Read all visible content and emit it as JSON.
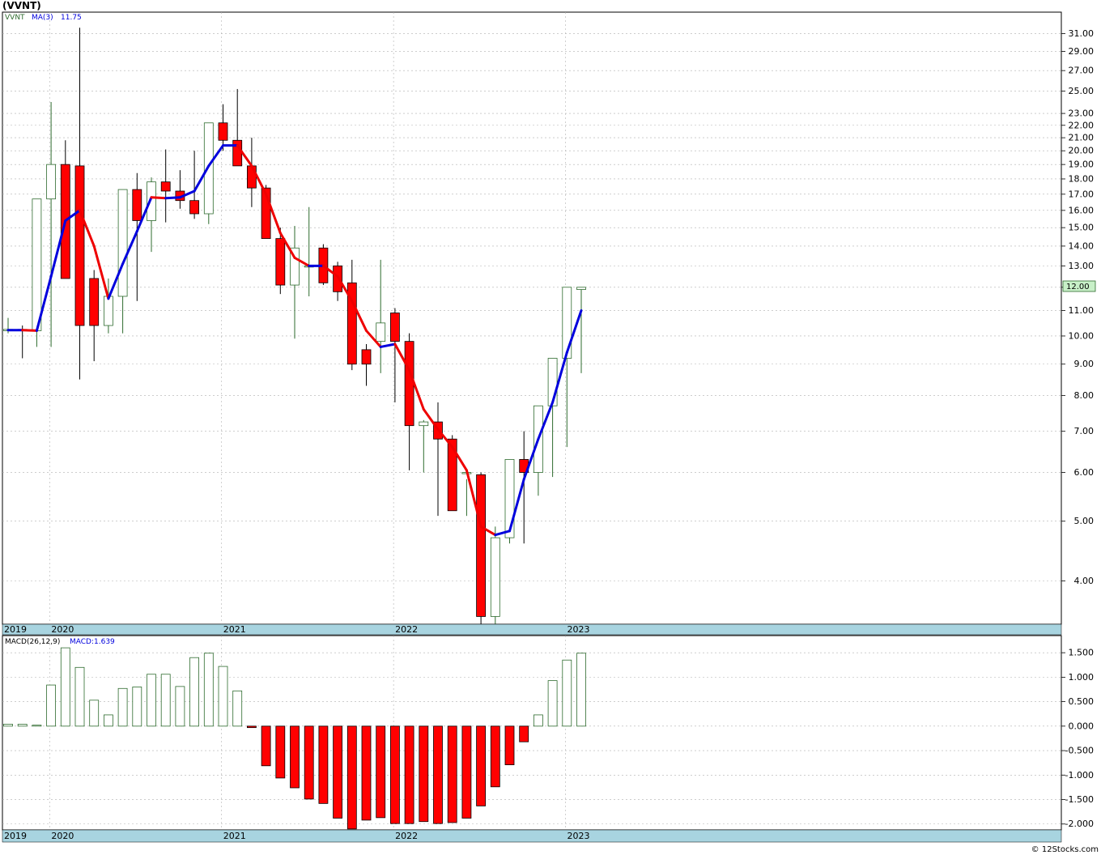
{
  "header": {
    "title": "(VVNT)"
  },
  "legend": {
    "symbol": "VVNT",
    "ma_label": "MA(3)",
    "ma_value": "11.75"
  },
  "macd_legend": {
    "params": "MACD(26,12,9)",
    "value": "MACD:1.639"
  },
  "price_axis": {
    "scale": "log",
    "range": [
      3.4,
      33.6
    ],
    "ticks": [
      "31.00",
      "29.00",
      "27.00",
      "25.00",
      "23.00",
      "22.00",
      "21.00",
      "20.00",
      "19.00",
      "18.00",
      "17.00",
      "16.00",
      "15.00",
      "14.00",
      "13.00",
      "12.00",
      "11.00",
      "10.00",
      "9.00",
      "8.00",
      "7.00",
      "6.00",
      "5.00",
      "4.00"
    ],
    "last_price_label": "12.00"
  },
  "macd_axis": {
    "range": [
      -2.12,
      1.85
    ],
    "ticks": [
      "1.500",
      "1.000",
      "0.500",
      "0.000",
      "-0.500",
      "-1.000",
      "-1.500",
      "-2.000"
    ]
  },
  "time_axis": {
    "labels": [
      "2019",
      "2020",
      "2021",
      "2022",
      "2023"
    ]
  },
  "footer": {
    "credit": "© 12Stocks.com"
  },
  "colors": {
    "up_candle": "#2e6b2e",
    "down_candle": "#ff0000",
    "ma_rising": "#0000dd",
    "ma_falling": "#ee0000",
    "time_band": "#a8d4e0",
    "last_price_box": "#c8f0c8"
  },
  "chart_data": [
    {
      "type": "candlestick",
      "title": "(VVNT)",
      "frequency": "monthly",
      "x": [
        "2019-11",
        "2019-12",
        "2020-01",
        "2020-02",
        "2020-03",
        "2020-04",
        "2020-05",
        "2020-06",
        "2020-07",
        "2020-08",
        "2020-09",
        "2020-10",
        "2020-11",
        "2020-12",
        "2021-01",
        "2021-02",
        "2021-03",
        "2021-04",
        "2021-05",
        "2021-06",
        "2021-07",
        "2021-08",
        "2021-09",
        "2021-10",
        "2021-11",
        "2021-12",
        "2022-01",
        "2022-02",
        "2022-03",
        "2022-04",
        "2022-05",
        "2022-06",
        "2022-07",
        "2022-08",
        "2022-09",
        "2022-10",
        "2022-11",
        "2022-12",
        "2023-01",
        "2023-02",
        "2023-03"
      ],
      "open": [
        10.2,
        10.25,
        10.2,
        16.7,
        19.0,
        18.9,
        12.4,
        10.4,
        11.6,
        17.3,
        15.4,
        17.8,
        17.2,
        16.6,
        15.8,
        22.2,
        20.8,
        18.9,
        17.4,
        14.4,
        12.1,
        13.0,
        13.9,
        13.0,
        12.2,
        9.5,
        9.8,
        10.9,
        9.8,
        7.15,
        7.25,
        6.8,
        6.0,
        5.95,
        3.5,
        4.7,
        6.3,
        6.0,
        7.7,
        9.2,
        11.9
      ],
      "high": [
        10.7,
        10.4,
        10.3,
        24.0,
        20.8,
        31.7,
        12.8,
        12.4,
        13.5,
        18.4,
        18.1,
        20.1,
        18.6,
        20.0,
        22.1,
        23.8,
        25.2,
        21.0,
        17.6,
        15.0,
        15.1,
        16.2,
        14.1,
        13.2,
        13.3,
        9.7,
        13.3,
        11.1,
        10.1,
        7.3,
        7.8,
        6.9,
        5.85,
        6.0,
        4.9,
        4.8,
        7.0,
        6.8,
        8.6,
        10.3,
        12.0
      ],
      "low": [
        10.1,
        9.2,
        9.6,
        9.6,
        12.5,
        8.5,
        9.1,
        10.1,
        10.1,
        11.4,
        13.7,
        15.3,
        16.1,
        15.5,
        15.2,
        20.0,
        20.0,
        16.2,
        15.1,
        11.7,
        9.9,
        11.6,
        12.1,
        11.4,
        8.8,
        8.3,
        8.7,
        7.8,
        6.05,
        6.0,
        5.1,
        5.2,
        5.1,
        3.3,
        3.3,
        4.6,
        4.6,
        5.5,
        5.9,
        6.6,
        8.7
      ],
      "close": [
        10.25,
        10.2,
        16.7,
        19.0,
        12.4,
        10.4,
        10.4,
        11.6,
        17.3,
        15.4,
        17.8,
        17.2,
        16.6,
        15.8,
        22.2,
        20.8,
        18.9,
        17.4,
        14.4,
        12.1,
        13.9,
        13.0,
        12.2,
        11.8,
        9.0,
        9.0,
        10.5,
        9.8,
        7.15,
        7.25,
        6.8,
        5.2,
        6.0,
        3.5,
        4.7,
        6.3,
        6.0,
        7.7,
        9.2,
        12.0,
        12.0
      ]
    },
    {
      "type": "line",
      "name": "MA(3)",
      "x": [
        "2019-11",
        "2019-12",
        "2020-01",
        "2020-02",
        "2020-03",
        "2020-04",
        "2020-05",
        "2020-06",
        "2020-07",
        "2020-08",
        "2020-09",
        "2020-10",
        "2020-11",
        "2020-12",
        "2021-01",
        "2021-02",
        "2021-03",
        "2021-04",
        "2021-05",
        "2021-06",
        "2021-07",
        "2021-08",
        "2021-09",
        "2021-10",
        "2021-11",
        "2021-12",
        "2022-01",
        "2022-02",
        "2022-03",
        "2022-04",
        "2022-05",
        "2022-06",
        "2022-07",
        "2022-08",
        "2022-09",
        "2022-10",
        "2022-11",
        "2022-12",
        "2023-01",
        "2023-02",
        "2023-03"
      ],
      "y": [
        10.22,
        10.22,
        10.2,
        12.5,
        15.4,
        16.0,
        14.0,
        11.5,
        13.1,
        14.8,
        16.8,
        16.75,
        16.8,
        17.2,
        18.9,
        20.4,
        20.4,
        18.9,
        17.0,
        14.7,
        13.4,
        13.0,
        13.0,
        12.5,
        11.4,
        10.2,
        9.6,
        9.7,
        8.8,
        7.6,
        7.05,
        6.6,
        6.05,
        4.9,
        4.75,
        4.82,
        5.85,
        6.8,
        7.8,
        9.4,
        11.0,
        11.65,
        11.7,
        11.75
      ],
      "y_note_dummy": null
    },
    {
      "type": "bar",
      "name": "MACD(26,12,9)",
      "x": [
        "2019-11",
        "2019-12",
        "2020-01",
        "2020-02",
        "2020-03",
        "2020-04",
        "2020-05",
        "2020-06",
        "2020-07",
        "2020-08",
        "2020-09",
        "2020-10",
        "2020-11",
        "2020-12",
        "2021-01",
        "2021-02",
        "2021-03",
        "2021-04",
        "2021-05",
        "2021-06",
        "2021-07",
        "2021-08",
        "2021-09",
        "2021-10",
        "2021-11",
        "2021-12",
        "2022-01",
        "2022-02",
        "2022-03",
        "2022-04",
        "2022-05",
        "2022-06",
        "2022-07",
        "2022-08",
        "2022-09",
        "2022-10",
        "2022-11",
        "2022-12",
        "2023-01",
        "2023-02",
        "2023-03"
      ],
      "values": [
        0.04,
        0.04,
        0.02,
        0.84,
        1.6,
        1.2,
        0.53,
        0.23,
        0.77,
        0.8,
        1.06,
        1.06,
        0.81,
        1.4,
        1.49,
        1.22,
        0.72,
        -0.03,
        -0.81,
        -1.06,
        -1.26,
        -1.49,
        -1.58,
        -1.88,
        -2.1,
        -1.92,
        -1.87,
        -1.99,
        -1.99,
        -1.95,
        -1.99,
        -1.97,
        -1.88,
        -1.63,
        -1.24,
        -0.79,
        -0.32,
        0.23,
        0.93,
        1.35,
        1.49,
        1.61,
        1.639
      ]
    }
  ]
}
